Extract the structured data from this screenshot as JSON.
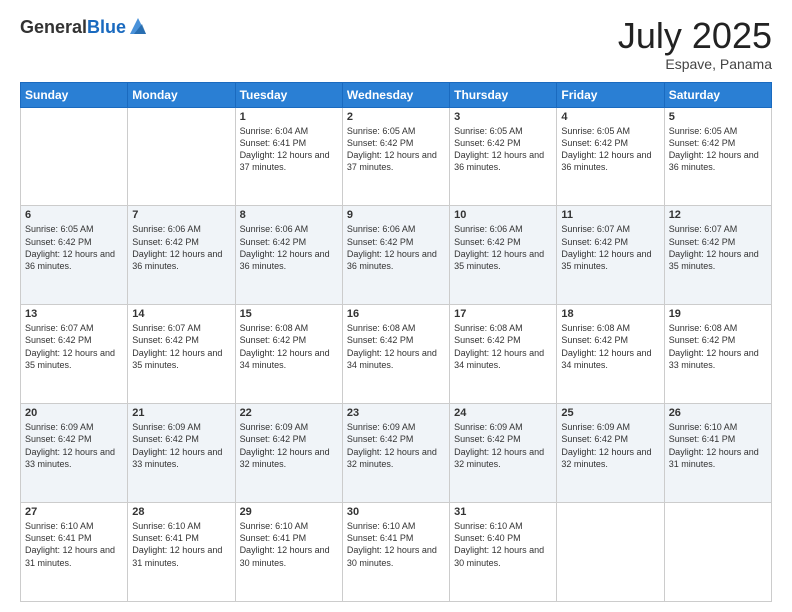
{
  "header": {
    "logo_general": "General",
    "logo_blue": "Blue",
    "month": "July 2025",
    "location": "Espave, Panama"
  },
  "days_of_week": [
    "Sunday",
    "Monday",
    "Tuesday",
    "Wednesday",
    "Thursday",
    "Friday",
    "Saturday"
  ],
  "weeks": [
    [
      {
        "day": "",
        "info": ""
      },
      {
        "day": "",
        "info": ""
      },
      {
        "day": "1",
        "info": "Sunrise: 6:04 AM\nSunset: 6:41 PM\nDaylight: 12 hours and 37 minutes."
      },
      {
        "day": "2",
        "info": "Sunrise: 6:05 AM\nSunset: 6:42 PM\nDaylight: 12 hours and 37 minutes."
      },
      {
        "day": "3",
        "info": "Sunrise: 6:05 AM\nSunset: 6:42 PM\nDaylight: 12 hours and 36 minutes."
      },
      {
        "day": "4",
        "info": "Sunrise: 6:05 AM\nSunset: 6:42 PM\nDaylight: 12 hours and 36 minutes."
      },
      {
        "day": "5",
        "info": "Sunrise: 6:05 AM\nSunset: 6:42 PM\nDaylight: 12 hours and 36 minutes."
      }
    ],
    [
      {
        "day": "6",
        "info": "Sunrise: 6:05 AM\nSunset: 6:42 PM\nDaylight: 12 hours and 36 minutes."
      },
      {
        "day": "7",
        "info": "Sunrise: 6:06 AM\nSunset: 6:42 PM\nDaylight: 12 hours and 36 minutes."
      },
      {
        "day": "8",
        "info": "Sunrise: 6:06 AM\nSunset: 6:42 PM\nDaylight: 12 hours and 36 minutes."
      },
      {
        "day": "9",
        "info": "Sunrise: 6:06 AM\nSunset: 6:42 PM\nDaylight: 12 hours and 36 minutes."
      },
      {
        "day": "10",
        "info": "Sunrise: 6:06 AM\nSunset: 6:42 PM\nDaylight: 12 hours and 35 minutes."
      },
      {
        "day": "11",
        "info": "Sunrise: 6:07 AM\nSunset: 6:42 PM\nDaylight: 12 hours and 35 minutes."
      },
      {
        "day": "12",
        "info": "Sunrise: 6:07 AM\nSunset: 6:42 PM\nDaylight: 12 hours and 35 minutes."
      }
    ],
    [
      {
        "day": "13",
        "info": "Sunrise: 6:07 AM\nSunset: 6:42 PM\nDaylight: 12 hours and 35 minutes."
      },
      {
        "day": "14",
        "info": "Sunrise: 6:07 AM\nSunset: 6:42 PM\nDaylight: 12 hours and 35 minutes."
      },
      {
        "day": "15",
        "info": "Sunrise: 6:08 AM\nSunset: 6:42 PM\nDaylight: 12 hours and 34 minutes."
      },
      {
        "day": "16",
        "info": "Sunrise: 6:08 AM\nSunset: 6:42 PM\nDaylight: 12 hours and 34 minutes."
      },
      {
        "day": "17",
        "info": "Sunrise: 6:08 AM\nSunset: 6:42 PM\nDaylight: 12 hours and 34 minutes."
      },
      {
        "day": "18",
        "info": "Sunrise: 6:08 AM\nSunset: 6:42 PM\nDaylight: 12 hours and 34 minutes."
      },
      {
        "day": "19",
        "info": "Sunrise: 6:08 AM\nSunset: 6:42 PM\nDaylight: 12 hours and 33 minutes."
      }
    ],
    [
      {
        "day": "20",
        "info": "Sunrise: 6:09 AM\nSunset: 6:42 PM\nDaylight: 12 hours and 33 minutes."
      },
      {
        "day": "21",
        "info": "Sunrise: 6:09 AM\nSunset: 6:42 PM\nDaylight: 12 hours and 33 minutes."
      },
      {
        "day": "22",
        "info": "Sunrise: 6:09 AM\nSunset: 6:42 PM\nDaylight: 12 hours and 32 minutes."
      },
      {
        "day": "23",
        "info": "Sunrise: 6:09 AM\nSunset: 6:42 PM\nDaylight: 12 hours and 32 minutes."
      },
      {
        "day": "24",
        "info": "Sunrise: 6:09 AM\nSunset: 6:42 PM\nDaylight: 12 hours and 32 minutes."
      },
      {
        "day": "25",
        "info": "Sunrise: 6:09 AM\nSunset: 6:42 PM\nDaylight: 12 hours and 32 minutes."
      },
      {
        "day": "26",
        "info": "Sunrise: 6:10 AM\nSunset: 6:41 PM\nDaylight: 12 hours and 31 minutes."
      }
    ],
    [
      {
        "day": "27",
        "info": "Sunrise: 6:10 AM\nSunset: 6:41 PM\nDaylight: 12 hours and 31 minutes."
      },
      {
        "day": "28",
        "info": "Sunrise: 6:10 AM\nSunset: 6:41 PM\nDaylight: 12 hours and 31 minutes."
      },
      {
        "day": "29",
        "info": "Sunrise: 6:10 AM\nSunset: 6:41 PM\nDaylight: 12 hours and 30 minutes."
      },
      {
        "day": "30",
        "info": "Sunrise: 6:10 AM\nSunset: 6:41 PM\nDaylight: 12 hours and 30 minutes."
      },
      {
        "day": "31",
        "info": "Sunrise: 6:10 AM\nSunset: 6:40 PM\nDaylight: 12 hours and 30 minutes."
      },
      {
        "day": "",
        "info": ""
      },
      {
        "day": "",
        "info": ""
      }
    ]
  ]
}
